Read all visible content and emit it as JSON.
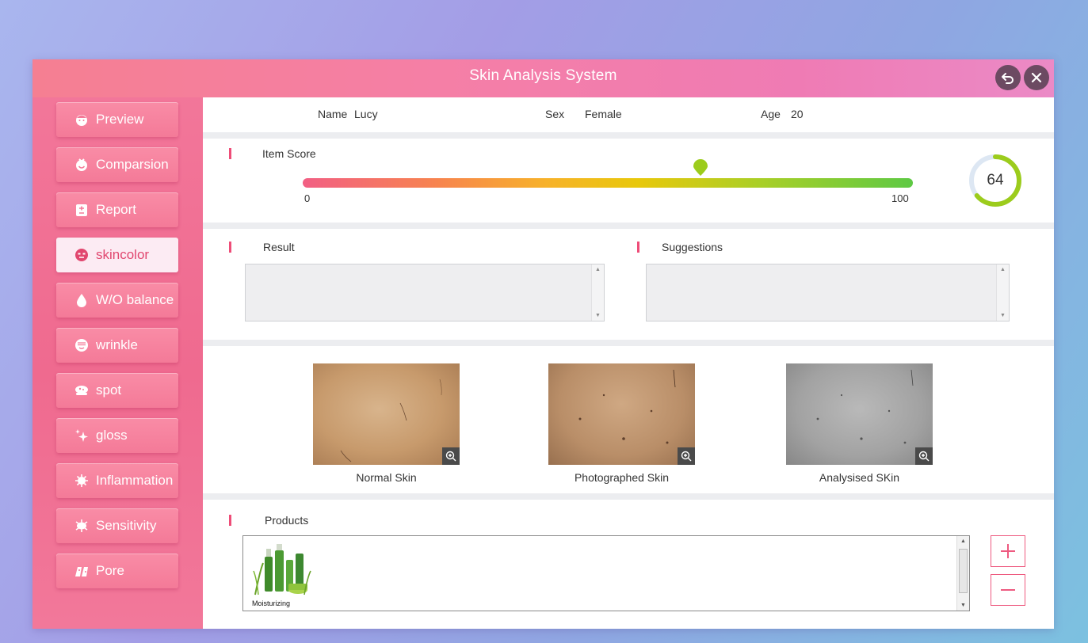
{
  "window": {
    "title": "Skin Analysis System"
  },
  "sidebar": {
    "items": [
      {
        "label": "Preview",
        "icon": "face-icon"
      },
      {
        "label": "Comparsion",
        "icon": "smile-face-icon"
      },
      {
        "label": "Report",
        "icon": "report-icon"
      },
      {
        "label": "skincolor",
        "icon": "mask-face-icon",
        "active": true
      },
      {
        "label": "W/O balance",
        "icon": "water-drop-icon"
      },
      {
        "label": "wrinkle",
        "icon": "wrinkle-face-icon"
      },
      {
        "label": "spot",
        "icon": "spot-icon"
      },
      {
        "label": "gloss",
        "icon": "sparkle-icon"
      },
      {
        "label": "Inflammation",
        "icon": "virus-icon"
      },
      {
        "label": "Sensitivity",
        "icon": "bacteria-icon"
      },
      {
        "label": "Pore",
        "icon": "pore-icon"
      }
    ]
  },
  "patient": {
    "name_label": "Name",
    "name": "Lucy",
    "sex_label": "Sex",
    "sex": "Female",
    "age_label": "Age",
    "age": "20"
  },
  "score": {
    "title": "Item Score",
    "min": "0",
    "max": "100",
    "value": "64"
  },
  "result": {
    "title": "Result",
    "text": ""
  },
  "suggestions": {
    "title": "Suggestions",
    "text": ""
  },
  "images": [
    {
      "caption": "Normal Skin"
    },
    {
      "caption": "Photographed Skin"
    },
    {
      "caption": "Analysised SKin"
    }
  ],
  "products": {
    "title": "Products",
    "items": [
      {
        "name": "Moisturizing"
      }
    ]
  },
  "colors": {
    "accent": "#ee4d78",
    "sidebar": "#f07594",
    "ring": "#9ccc1c"
  }
}
